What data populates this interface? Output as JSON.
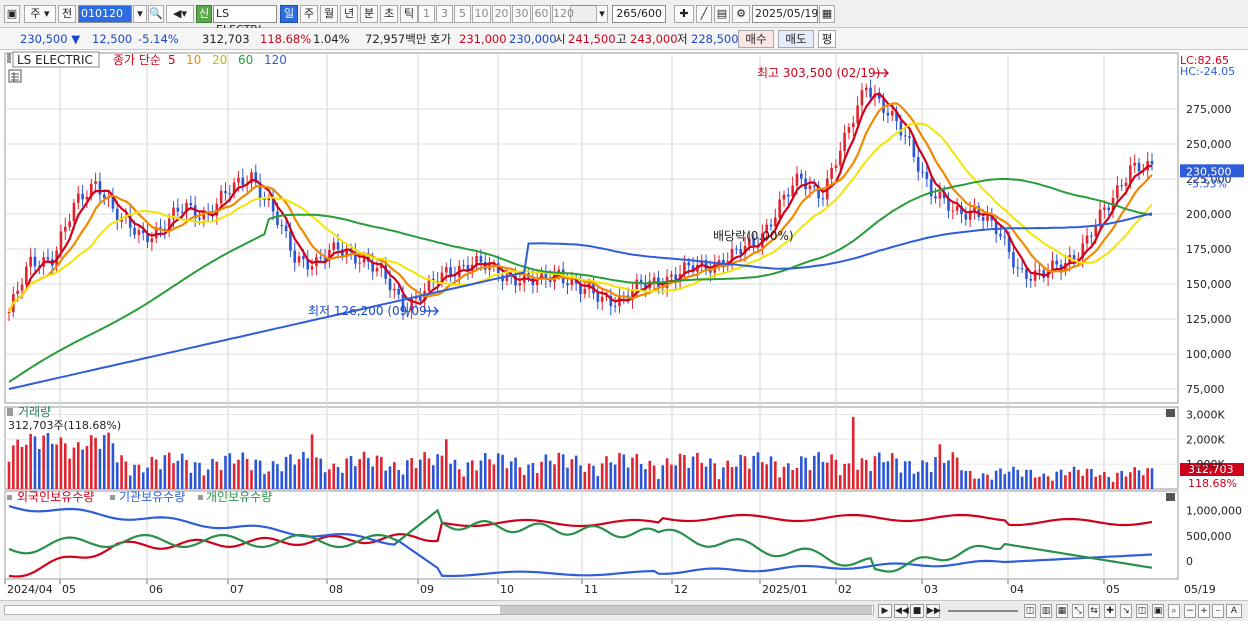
{
  "toolbar": {
    "market": "주",
    "period_label": "전",
    "code": "010120",
    "stock_name": "LS ELECTRI",
    "badge_new": "신",
    "periods": [
      "일",
      "주",
      "월",
      "년",
      "분",
      "초",
      "틱"
    ],
    "active_period": "일",
    "intervals": [
      "1",
      "3",
      "5",
      "10",
      "20",
      "30",
      "60",
      "120"
    ],
    "count": "265/600",
    "date": "2025/05/19"
  },
  "info": {
    "price": "230,500",
    "change": "12,500",
    "change_pct": "-5.14%",
    "volume": "312,703",
    "volume_ratio": "118.68%",
    "turnover": "1.04%",
    "amount": "72,957백만",
    "quote_label": "호가",
    "ask": "231,000",
    "bid": "230,000",
    "open_label": "시",
    "open": "241,500",
    "high_label": "고",
    "high": "243,000",
    "low_label": "저",
    "low": "228,500",
    "buy_button": "매수",
    "sell_button": "매도",
    "eval_button": "평"
  },
  "legend": {
    "name": "LS ELECTRIC",
    "ma_title": "종가 단순",
    "ma": [
      "5",
      "10",
      "20",
      "60",
      "120"
    ],
    "ma_colors": [
      "#d0021b",
      "#f08a00",
      "#f2e600",
      "#2a9d3a",
      "#2f5ed8"
    ],
    "lc": "LC:82.65",
    "hc": "HC:-24.05"
  },
  "annotations": {
    "high": "최고 303,500 (02/19)",
    "low": "최저 126,200 (09/09)",
    "dividend": "배당락(0.00%)"
  },
  "price_axis": [
    "275,000",
    "250,000",
    "225,000",
    "200,000",
    "175,000",
    "150,000",
    "125,000",
    "100,000",
    "75,000"
  ],
  "price_tag": "230,500",
  "price_tag_pct": "-5.53%",
  "volume_panel": {
    "title": "거래량",
    "value": "312,703주(118.68%)",
    "axis": [
      "3,000K",
      "2,000K",
      "1,000K"
    ],
    "tag": "312,703",
    "tag_pct": "118.68%"
  },
  "holdings_panel": {
    "foreign": "외국인보유수량",
    "institution": "기관보유수량",
    "individual": "개인보유수량",
    "axis": [
      "1,000,000",
      "500,000",
      "0"
    ],
    "colors": {
      "foreign": "#d0021b",
      "institution": "#2f5ed8",
      "individual": "#2a8f4a"
    }
  },
  "x_axis": [
    "2024/04",
    "05",
    "06",
    "07",
    "08",
    "09",
    "10",
    "11",
    "12",
    "2025/01",
    "02",
    "03",
    "04",
    "05"
  ],
  "x_axis_right": "05/19",
  "chart_data": {
    "type": "candlestick",
    "x_range": [
      "2024/04",
      "2025/05/19"
    ],
    "ylim": [
      65000,
      315000
    ],
    "close_series_approx": [
      [
        0,
        130000
      ],
      [
        1,
        165000
      ],
      [
        2,
        170000
      ],
      [
        3,
        205000
      ],
      [
        4,
        225000
      ],
      [
        5,
        195000
      ],
      [
        6,
        185000
      ],
      [
        7,
        190000
      ],
      [
        8,
        205000
      ],
      [
        9,
        200000
      ],
      [
        10,
        215000
      ],
      [
        11,
        230000
      ],
      [
        12,
        200000
      ],
      [
        13,
        170000
      ],
      [
        14,
        165000
      ],
      [
        15,
        175000
      ],
      [
        16,
        170000
      ],
      [
        17,
        155000
      ],
      [
        18,
        135000
      ],
      [
        19,
        145000
      ],
      [
        20,
        160000
      ],
      [
        21,
        165000
      ],
      [
        22,
        160000
      ],
      [
        23,
        155000
      ],
      [
        24,
        150000
      ],
      [
        25,
        160000
      ],
      [
        26,
        145000
      ],
      [
        27,
        140000
      ],
      [
        28,
        140000
      ],
      [
        29,
        150000
      ],
      [
        30,
        155000
      ],
      [
        31,
        160000
      ],
      [
        32,
        165000
      ],
      [
        33,
        170000
      ],
      [
        34,
        180000
      ],
      [
        35,
        205000
      ],
      [
        36,
        225000
      ],
      [
        37,
        215000
      ],
      [
        38,
        250000
      ],
      [
        39,
        295000
      ],
      [
        40,
        270000
      ],
      [
        41,
        250000
      ],
      [
        42,
        215000
      ],
      [
        43,
        200000
      ],
      [
        44,
        205000
      ],
      [
        45,
        185000
      ],
      [
        46,
        160000
      ],
      [
        47,
        155000
      ],
      [
        48,
        165000
      ],
      [
        49,
        180000
      ],
      [
        50,
        205000
      ],
      [
        51,
        235000
      ],
      [
        52,
        230500
      ]
    ]
  }
}
